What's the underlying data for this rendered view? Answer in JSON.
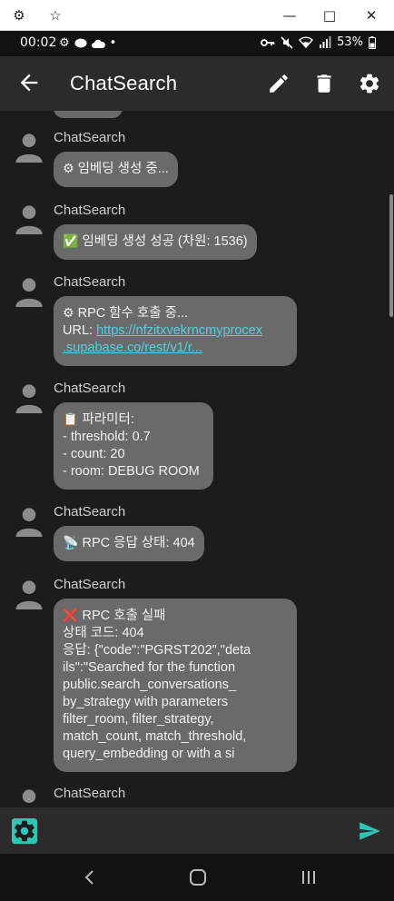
{
  "window": {
    "gear_icon": "⚙",
    "pin_icon": "☆",
    "minimize_icon": "—",
    "maximize_icon": "□",
    "close_icon": "✕"
  },
  "status_bar": {
    "time": "00:02",
    "battery": "53%"
  },
  "app_bar": {
    "title": "ChatSearch"
  },
  "messages": [
    {
      "sender": "ChatSearch",
      "emoji": "⚙",
      "lines": [
        "임베딩 생성 중..."
      ]
    },
    {
      "sender": "ChatSearch",
      "emoji": "✅",
      "lines": [
        "임베딩 생성 성공 (차원: 1536)"
      ]
    },
    {
      "sender": "ChatSearch",
      "emoji": "⚙",
      "lines": [
        "RPC 함수 호출 중..."
      ],
      "url_label": "URL: ",
      "url_line1": "https://nfzitxvekrncmyprocex",
      "url_line2": ".supabase.co/rest/v1/r..."
    },
    {
      "sender": "ChatSearch",
      "emoji": "📋",
      "lines": [
        "파라미터:",
        "- threshold: 0.7",
        "- count: 20",
        "- room: DEBUG ROOM"
      ]
    },
    {
      "sender": "ChatSearch",
      "emoji": "📡",
      "lines": [
        "RPC 응답 상태: 404"
      ]
    },
    {
      "sender": "ChatSearch",
      "emoji": "❌",
      "lines": [
        "RPC 호출 실패",
        "상태 코드: 404",
        "응답: {\"code\":\"PGRST202\",\"deta",
        "ils\":\"Searched for the function",
        "public.search_conversations_",
        "by_strategy with parameters",
        "filter_room, filter_strategy,",
        "match_count, match_threshold,",
        "query_embedding or with a si"
      ]
    },
    {
      "sender": "ChatSearch"
    }
  ],
  "input": {
    "placeholder": ""
  },
  "colors": {
    "accent": "#2ec4b6",
    "bubble": "#6a6a6a",
    "link": "#4fd1e6"
  }
}
